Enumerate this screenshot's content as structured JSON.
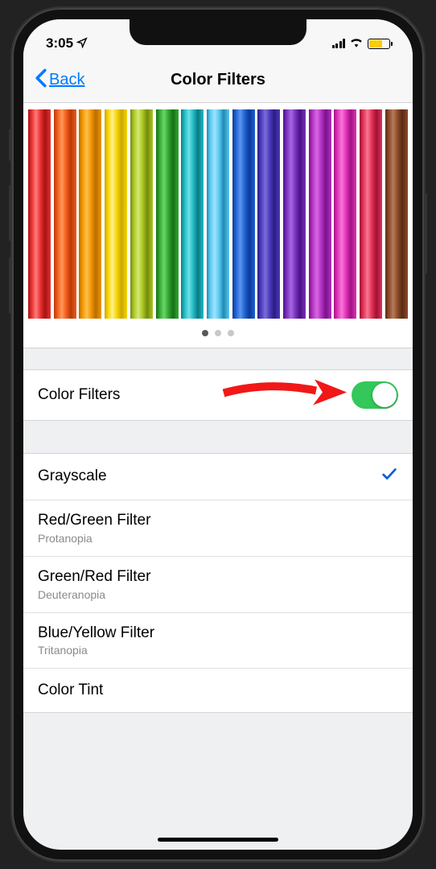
{
  "status": {
    "time": "3:05",
    "location_icon": "location-arrow"
  },
  "nav": {
    "back_label": "Back",
    "title": "Color Filters"
  },
  "pencil_colors": [
    {
      "c": "#e63030",
      "cl": "#ff7a7a",
      "cd": "#a81212"
    },
    {
      "c": "#f25a1a",
      "cl": "#ff9a5a",
      "cd": "#b83a08"
    },
    {
      "c": "#f29500",
      "cl": "#ffc04a",
      "cd": "#b86e00"
    },
    {
      "c": "#f5d400",
      "cl": "#fff08a",
      "cd": "#c9a800"
    },
    {
      "c": "#a8c720",
      "cl": "#d4e87a",
      "cd": "#738a0a"
    },
    {
      "c": "#2fa82f",
      "cl": "#6cd46c",
      "cd": "#157015"
    },
    {
      "c": "#1fbac4",
      "cl": "#6ee0e8",
      "cd": "#0a7a82"
    },
    {
      "c": "#58c8f0",
      "cl": "#a0e4ff",
      "cd": "#2089b0"
    },
    {
      "c": "#2060d4",
      "cl": "#5a96f0",
      "cd": "#0a3a94"
    },
    {
      "c": "#4a3abc",
      "cl": "#7a6cd8",
      "cd": "#2a1c82"
    },
    {
      "c": "#7830c0",
      "cl": "#a868e0",
      "cd": "#4a1280"
    },
    {
      "c": "#b230c4",
      "cl": "#d868e0",
      "cd": "#7a1285"
    },
    {
      "c": "#e030b8",
      "cl": "#f878d8",
      "cd": "#a01280"
    },
    {
      "c": "#e03058",
      "cl": "#f87890",
      "cd": "#a01232"
    },
    {
      "c": "#8a4a2a",
      "cl": "#b87a5a",
      "cd": "#5a2a12"
    }
  ],
  "pager": {
    "active": 0,
    "count": 3
  },
  "toggle_row": {
    "label": "Color Filters",
    "on": true
  },
  "options": [
    {
      "label": "Grayscale",
      "sublabel": null,
      "selected": true
    },
    {
      "label": "Red/Green Filter",
      "sublabel": "Protanopia",
      "selected": false
    },
    {
      "label": "Green/Red Filter",
      "sublabel": "Deuteranopia",
      "selected": false
    },
    {
      "label": "Blue/Yellow Filter",
      "sublabel": "Tritanopia",
      "selected": false
    },
    {
      "label": "Color Tint",
      "sublabel": null,
      "selected": false
    }
  ]
}
